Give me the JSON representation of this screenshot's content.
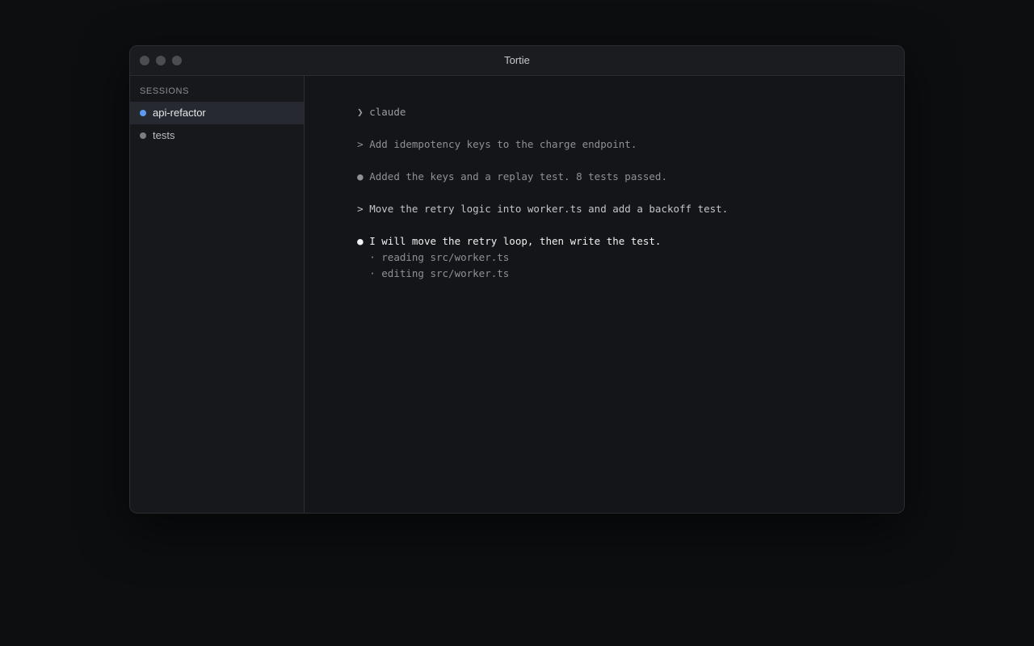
{
  "window": {
    "title": "Tortie"
  },
  "sidebar": {
    "heading": "SESSIONS",
    "sessions": [
      {
        "name": "api-refactor",
        "active": true,
        "dot_color": "#5b9bf0"
      },
      {
        "name": "tests",
        "active": false,
        "dot_color": "#7a7d82"
      }
    ]
  },
  "terminal": {
    "lines": [
      {
        "prefix": "❯ ",
        "text": "claude",
        "color": "#9a9da2"
      },
      {
        "prefix": "> ",
        "text": "Add idempotency keys to the charge endpoint.",
        "color": "#8e9196"
      },
      {
        "prefix": "● ",
        "text": "Added the keys and a replay test. 8 tests passed.",
        "color": "#8e9196"
      },
      {
        "prefix": "> ",
        "text": "Move the retry logic into worker.ts and add a backoff test.",
        "color": "#c2c5c9"
      },
      {
        "prefix": "● ",
        "text": "I will move the retry loop, then write the test.",
        "color": "#f0f1f2"
      },
      {
        "prefix": "  · ",
        "text": "reading src/worker.ts",
        "color": "#8e9196"
      },
      {
        "prefix": "  · ",
        "text": "editing src/worker.ts",
        "color": "#8e9196"
      }
    ]
  },
  "colors": {
    "background": "#0c0e0f",
    "window": "#141619",
    "active_session_bg": "#262a30",
    "active_accent": "#5b9bf0"
  }
}
